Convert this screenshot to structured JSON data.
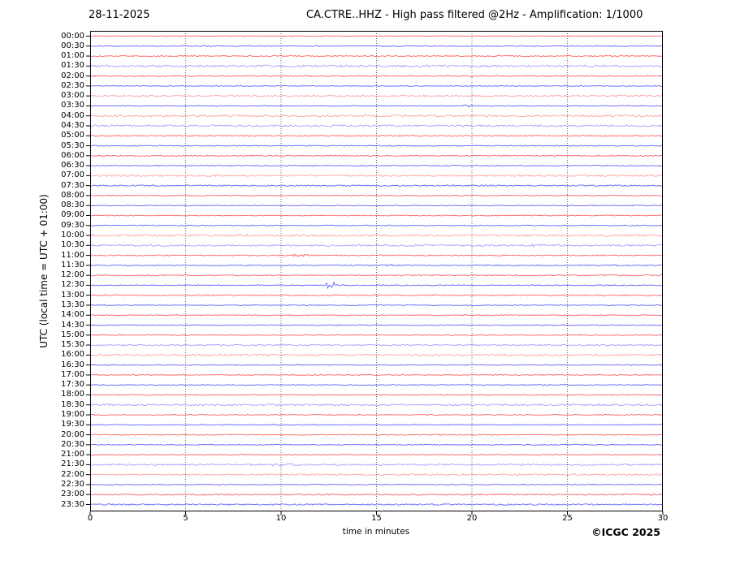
{
  "header": {
    "date": "28-11-2025",
    "title": "CA.CTRE..HHZ - High pass filtered @2Hz - Amplification: 1/1000"
  },
  "y_axis": {
    "label": "UTC (local time = UTC + 01:00)"
  },
  "x_axis": {
    "label": "time in minutes",
    "ticks": [
      0,
      5,
      10,
      15,
      20,
      25,
      30
    ]
  },
  "footer": {
    "copyright": "©ICGC 2025"
  },
  "colors": {
    "trace_red": "#ff2020",
    "trace_blue": "#2020ff",
    "grid": "#555555",
    "border": "#000000",
    "background": "#ffffff"
  },
  "chart_data": {
    "type": "line",
    "subtype": "helicorder-daily-seismogram",
    "station": "CA.CTRE..HHZ",
    "filter": "High pass filtered @2Hz",
    "amplification": "1/1000",
    "date": "28-11-2025",
    "x_min_minutes": 0,
    "x_max_minutes": 30,
    "gridlines_minutes": [
      5,
      10,
      15,
      20,
      25
    ],
    "minutes_per_row": 30,
    "row_note": "48 half-hour traces, hour rows red, half-hour rows blue; n = background noise amplitude (px), e = events [center_min, width_min, amplitude_px]",
    "rows": [
      {
        "t": "00:00",
        "c": "r",
        "n": 0.5
      },
      {
        "t": "00:30",
        "c": "b",
        "n": 0.5,
        "e": [
          [
            6.3,
            0.9,
            0.7
          ]
        ]
      },
      {
        "t": "01:00",
        "c": "r",
        "n": 0.8
      },
      {
        "t": "01:30",
        "c": "b",
        "n": 1.4
      },
      {
        "t": "02:00",
        "c": "r",
        "n": 0.9
      },
      {
        "t": "02:30",
        "c": "b",
        "n": 0.5
      },
      {
        "t": "03:00",
        "c": "r",
        "n": 1.2
      },
      {
        "t": "03:30",
        "c": "b",
        "n": 0.5,
        "e": [
          [
            19.72,
            0.4,
            3.0
          ]
        ]
      },
      {
        "t": "04:00",
        "c": "r",
        "n": 1.3
      },
      {
        "t": "04:30",
        "c": "b",
        "n": 1.3
      },
      {
        "t": "05:00",
        "c": "r",
        "n": 0.8
      },
      {
        "t": "05:30",
        "c": "b",
        "n": 0.6
      },
      {
        "t": "06:00",
        "c": "r",
        "n": 0.8
      },
      {
        "t": "06:30",
        "c": "b",
        "n": 0.7
      },
      {
        "t": "07:00",
        "c": "r",
        "n": 1.1
      },
      {
        "t": "07:30",
        "c": "b",
        "n": 0.9
      },
      {
        "t": "08:00",
        "c": "r",
        "n": 0.6
      },
      {
        "t": "08:30",
        "c": "b",
        "n": 0.6
      },
      {
        "t": "09:00",
        "c": "r",
        "n": 0.6
      },
      {
        "t": "09:30",
        "c": "b",
        "n": 0.6
      },
      {
        "t": "10:00",
        "c": "r",
        "n": 1.3
      },
      {
        "t": "10:30",
        "c": "b",
        "n": 1.2,
        "e": [
          [
            20.8,
            0.5,
            0.9
          ],
          [
            23.4,
            0.5,
            0.9
          ]
        ]
      },
      {
        "t": "11:00",
        "c": "r",
        "n": 0.7,
        "e": [
          [
            10.9,
            1.2,
            0.9
          ]
        ]
      },
      {
        "t": "11:30",
        "c": "b",
        "n": 0.7,
        "e": [
          [
            15.7,
            0.8,
            0.8
          ]
        ]
      },
      {
        "t": "12:00",
        "c": "r",
        "n": 0.8
      },
      {
        "t": "12:30",
        "c": "b",
        "n": 0.7,
        "e": [
          [
            12.45,
            0.25,
            3.2
          ],
          [
            12.75,
            0.3,
            3.2
          ]
        ]
      },
      {
        "t": "13:00",
        "c": "r",
        "n": 0.8
      },
      {
        "t": "13:30",
        "c": "b",
        "n": 0.6
      },
      {
        "t": "14:00",
        "c": "r",
        "n": 0.6
      },
      {
        "t": "14:30",
        "c": "b",
        "n": 0.6
      },
      {
        "t": "15:00",
        "c": "r",
        "n": 0.6
      },
      {
        "t": "15:30",
        "c": "b",
        "n": 1.0
      },
      {
        "t": "16:00",
        "c": "r",
        "n": 1.2
      },
      {
        "t": "16:30",
        "c": "b",
        "n": 0.6
      },
      {
        "t": "17:00",
        "c": "r",
        "n": 0.6
      },
      {
        "t": "17:30",
        "c": "b",
        "n": 0.6
      },
      {
        "t": "18:00",
        "c": "r",
        "n": 0.7
      },
      {
        "t": "18:30",
        "c": "b",
        "n": 1.2
      },
      {
        "t": "19:00",
        "c": "r",
        "n": 0.7
      },
      {
        "t": "19:30",
        "c": "b",
        "n": 0.6
      },
      {
        "t": "20:00",
        "c": "r",
        "n": 0.6,
        "e": [
          [
            18.35,
            0.5,
            0.8
          ]
        ]
      },
      {
        "t": "20:30",
        "c": "b",
        "n": 0.6
      },
      {
        "t": "21:00",
        "c": "r",
        "n": 0.6
      },
      {
        "t": "21:30",
        "c": "b",
        "n": 1.1,
        "e": [
          [
            10.0,
            1.1,
            1.2
          ]
        ]
      },
      {
        "t": "22:00",
        "c": "r",
        "n": 1.1
      },
      {
        "t": "22:30",
        "c": "b",
        "n": 0.6
      },
      {
        "t": "23:00",
        "c": "r",
        "n": 0.9
      },
      {
        "t": "23:30",
        "c": "b",
        "n": 0.9
      }
    ]
  }
}
